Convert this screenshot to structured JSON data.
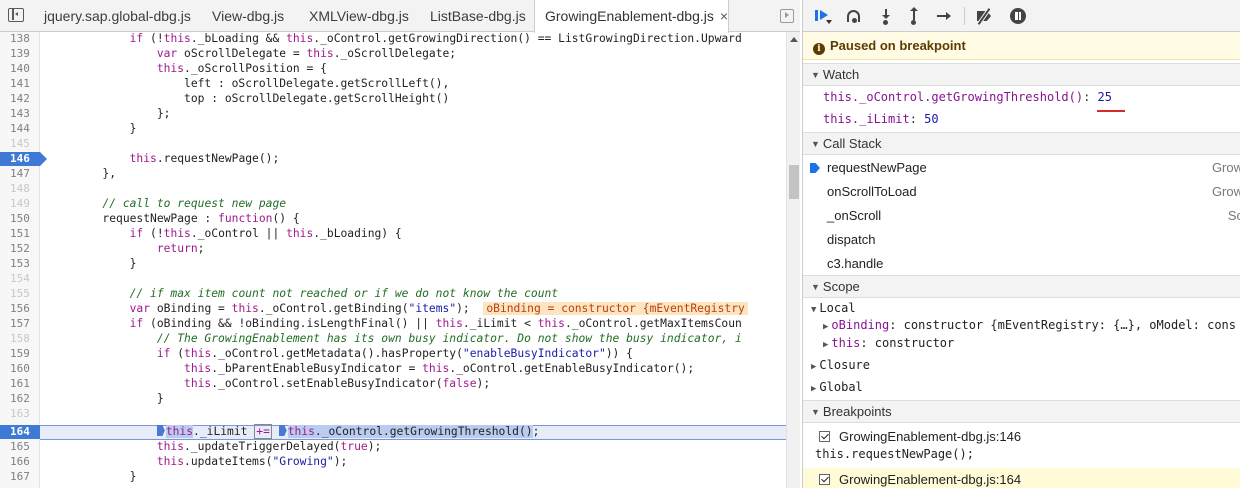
{
  "editor": {
    "tabs": [
      {
        "label": "jquery.sap.global-dbg.js"
      },
      {
        "label": "View-dbg.js"
      },
      {
        "label": "XMLView-dbg.js"
      },
      {
        "label": "ListBase-dbg.js"
      },
      {
        "label": "GrowingEnablement-dbg.js",
        "active": true,
        "close": "×"
      }
    ],
    "line_numbers": [
      "138",
      "139",
      "140",
      "141",
      "142",
      "143",
      "144",
      "145",
      "146",
      "147",
      "148",
      "149",
      "150",
      "151",
      "152",
      "153",
      "154",
      "155",
      "156",
      "157",
      "158",
      "159",
      "160",
      "161",
      "162",
      "163",
      "164",
      "165",
      "166",
      "167"
    ],
    "breakpoint_lines": [
      "146",
      "164"
    ],
    "inline_value": "oBinding = constructor {mEventRegistry",
    "current_line": "164"
  },
  "debugger": {
    "paused_label": "Paused on breakpoint",
    "info_glyph": "i",
    "sections": {
      "watch": "Watch",
      "call_stack": "Call Stack",
      "scope": "Scope",
      "breakpoints": "Breakpoints"
    },
    "watch": [
      {
        "expr": "this._oControl.getGrowingThreshold()",
        "sep": ": ",
        "value": "25"
      },
      {
        "expr": "this._iLimit",
        "sep": ": ",
        "value": "50"
      }
    ],
    "call_stack": [
      {
        "name": "requestNewPage",
        "loc": "Grow",
        "current": true
      },
      {
        "name": "onScrollToLoad",
        "loc": "Grow"
      },
      {
        "name": "_onScroll",
        "loc": "Sc"
      },
      {
        "name": "dispatch",
        "loc": ""
      },
      {
        "name": "c3.handle",
        "loc": ""
      }
    ],
    "scope": {
      "local_label": "Local",
      "local_items": [
        {
          "name": "oBinding",
          "value": ": constructor {mEventRegistry: {…}, oModel: cons"
        },
        {
          "name": "this",
          "value": ": constructor"
        }
      ],
      "closure_label": "Closure",
      "global_label": "Global"
    },
    "breakpoints": [
      {
        "label": "GrowingEnablement-dbg.js:146",
        "code": "this.requestNewPage();"
      },
      {
        "label": "GrowingEnablement-dbg.js:164",
        "active": true
      }
    ]
  }
}
